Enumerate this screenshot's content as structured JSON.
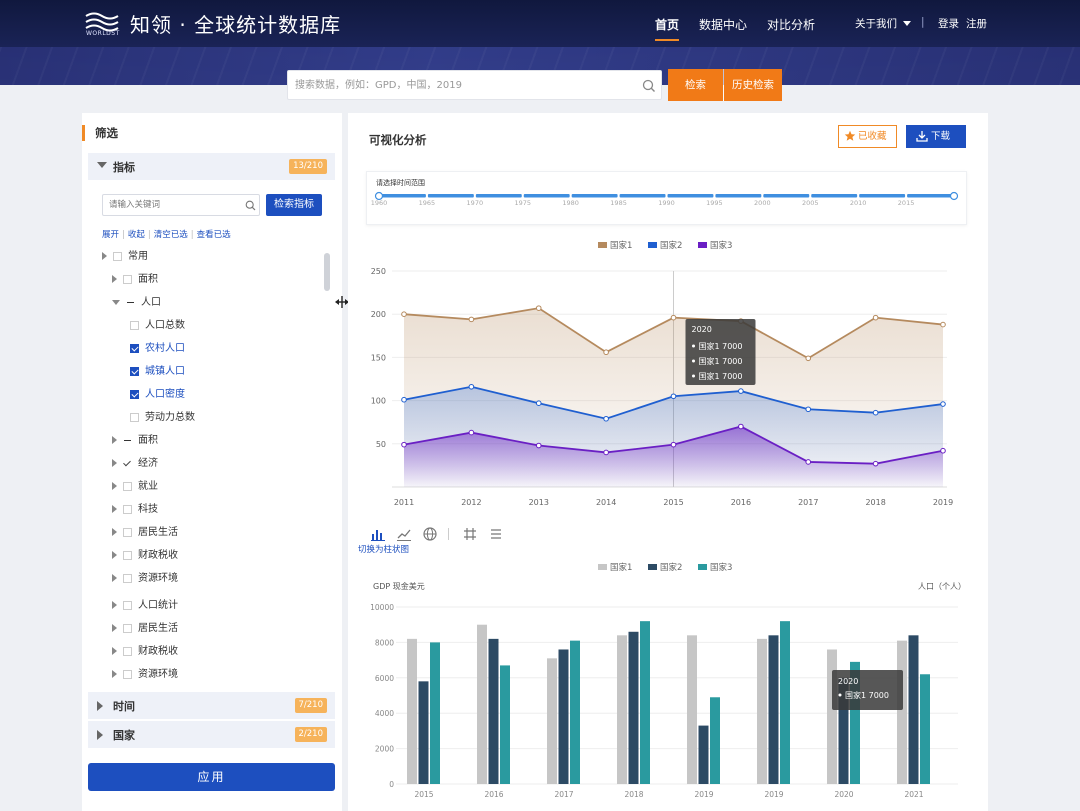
{
  "header": {
    "logo_sub": "WORLDST",
    "site_title": "知领 · 全球统计数据库",
    "nav": [
      {
        "label": "首页",
        "active": true
      },
      {
        "label": "数据中心",
        "active": false
      },
      {
        "label": "对比分析",
        "active": false
      }
    ],
    "about": "关于我们",
    "login": "登录",
    "register": "注册"
  },
  "search": {
    "placeholder": "搜索数据，例如：GPD，中国，2019",
    "search_button": "检索",
    "history_button": "历史检索"
  },
  "filter": {
    "title": "筛选",
    "groups": [
      {
        "label": "指标",
        "count": "13/210",
        "expanded": true
      },
      {
        "label": "时间",
        "count": "7/210",
        "expanded": false
      },
      {
        "label": "国家",
        "count": "2/210",
        "expanded": false
      }
    ],
    "keyword_placeholder": "请输入关键词",
    "keyword_button": "检索指标",
    "quick_links": [
      "展开",
      "收起",
      "清空已选",
      "查看已选"
    ],
    "tree": [
      {
        "label": "常用",
        "level": 0,
        "toggle": "closed",
        "check": "empty"
      },
      {
        "label": "面积",
        "level": 1,
        "toggle": "closed",
        "check": "empty"
      },
      {
        "label": "人口",
        "level": 1,
        "toggle": "open",
        "check": "dash"
      },
      {
        "label": "人口总数",
        "level": 2,
        "toggle": "none",
        "check": "empty"
      },
      {
        "label": "农村人口",
        "level": 2,
        "toggle": "none",
        "check": "checked"
      },
      {
        "label": "城镇人口",
        "level": 2,
        "toggle": "none",
        "check": "checked"
      },
      {
        "label": "人口密度",
        "level": 2,
        "toggle": "none",
        "check": "checked"
      },
      {
        "label": "劳动力总数",
        "level": 2,
        "toggle": "none",
        "check": "empty"
      },
      {
        "label": "面积",
        "level": 1,
        "toggle": "closed",
        "check": "dash"
      },
      {
        "label": "经济",
        "level": 1,
        "toggle": "closed",
        "check": "tick"
      },
      {
        "label": "就业",
        "level": 1,
        "toggle": "closed",
        "check": "empty"
      },
      {
        "label": "科技",
        "level": 1,
        "toggle": "closed",
        "check": "empty"
      },
      {
        "label": "居民生活",
        "level": 1,
        "toggle": "closed",
        "check": "empty"
      },
      {
        "label": "财政税收",
        "level": 1,
        "toggle": "closed",
        "check": "empty"
      },
      {
        "label": "资源环境",
        "level": 1,
        "toggle": "closed",
        "check": "empty"
      },
      {
        "label": "人口统计",
        "level": 1,
        "toggle": "closed",
        "check": "empty"
      },
      {
        "label": "居民生活",
        "level": 1,
        "toggle": "closed",
        "check": "empty"
      },
      {
        "label": "财政税收",
        "level": 1,
        "toggle": "closed",
        "check": "empty"
      },
      {
        "label": "资源环境",
        "level": 1,
        "toggle": "closed",
        "check": "empty"
      }
    ],
    "apply_button": "应用"
  },
  "main": {
    "title": "可视化分析",
    "favorite_button": "已收藏",
    "download_button": "下载",
    "time_range_label": "请选择时间范围",
    "time_ticks": [
      "1960",
      "1965",
      "1970",
      "1975",
      "1980",
      "1985",
      "1990",
      "1995",
      "2000",
      "2005",
      "2010",
      "2015"
    ],
    "toolbar_icons": [
      "bar-chart-icon",
      "line-chart-icon",
      "globe-icon",
      "grid-icon",
      "list-icon"
    ],
    "switch_label": "切换为柱状图"
  },
  "colors": {
    "series_line": [
      "#b58a5e",
      "#1f5fd0",
      "#6a1fc4"
    ],
    "series_bar": [
      "#c6c6c6",
      "#2c4a64",
      "#2a9a9f"
    ],
    "brand": "#1d4fbf",
    "accent": "#f17a17"
  },
  "chart_data": [
    {
      "type": "area",
      "x": [
        2011,
        2012,
        2013,
        2014,
        2015,
        2016,
        2017,
        2018,
        2019
      ],
      "series": [
        {
          "name": "国家1",
          "values": [
            200,
            194,
            207,
            156,
            196,
            192,
            149,
            196,
            188
          ]
        },
        {
          "name": "国家2",
          "values": [
            101,
            116,
            97,
            79,
            105,
            111,
            90,
            86,
            96
          ]
        },
        {
          "name": "国家3",
          "values": [
            49,
            63,
            48,
            40,
            49,
            70,
            29,
            27,
            42
          ]
        }
      ],
      "ylim": [
        0,
        250
      ],
      "yticks": [
        50,
        100,
        150,
        200,
        250
      ],
      "grid": true,
      "legend": "top-center",
      "tooltip": {
        "title": "2020",
        "lines": [
          "国家1 7000",
          "国家1 7000",
          "国家1 7000"
        ],
        "at": 2015
      }
    },
    {
      "type": "bar",
      "categories": [
        "2015",
        "2016",
        "2017",
        "2018",
        "2019",
        "2019",
        "2020",
        "2021"
      ],
      "series": [
        {
          "name": "国家1",
          "values": [
            8200,
            9000,
            7100,
            8400,
            8400,
            8200,
            7600,
            8100
          ]
        },
        {
          "name": "国家2",
          "values": [
            5800,
            8200,
            7600,
            8600,
            3300,
            8400,
            6000,
            8400
          ]
        },
        {
          "name": "国家3",
          "values": [
            8000,
            6700,
            8100,
            9200,
            4900,
            9200,
            6900,
            6200
          ]
        }
      ],
      "ylabel": "GDP 现金美元",
      "ylabel_right": "人口（个人）",
      "ylim": [
        0,
        10000
      ],
      "yticks": [
        0,
        2000,
        4000,
        6000,
        8000,
        10000
      ],
      "grid": true,
      "legend": "top-center",
      "tooltip": {
        "title": "2020",
        "lines": [
          "国家1 7000"
        ],
        "at": "2020"
      }
    }
  ]
}
